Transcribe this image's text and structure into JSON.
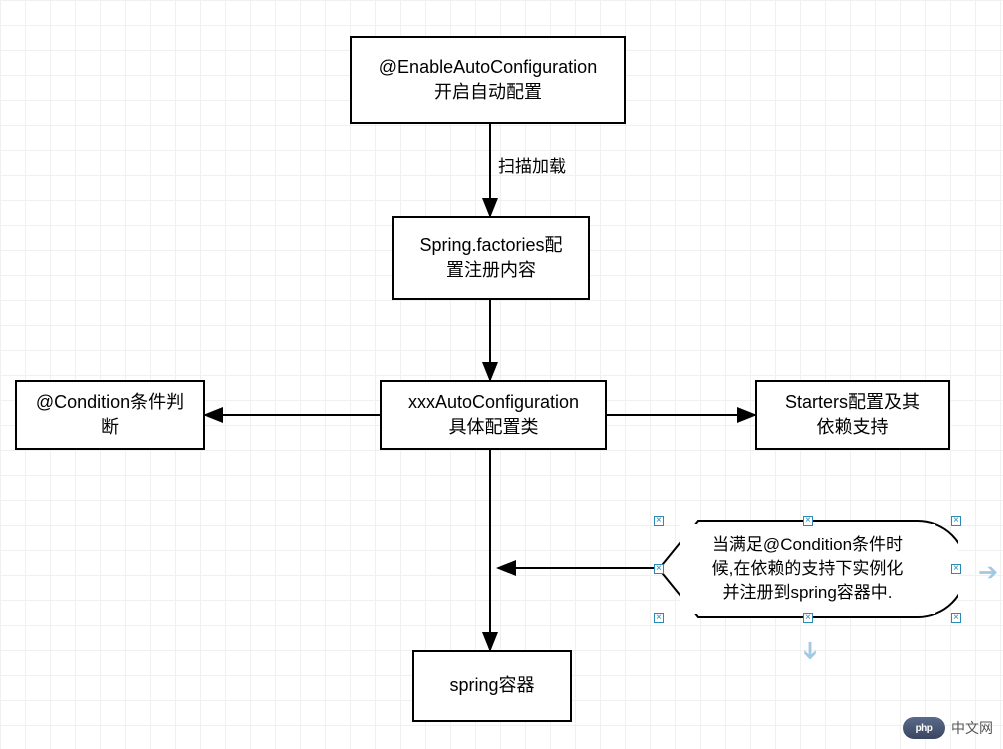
{
  "nodes": {
    "enable": {
      "line1": "@EnableAutoConfiguration",
      "line2": "开启自动配置"
    },
    "factories": {
      "line1": "Spring.factories配",
      "line2": "置注册内容"
    },
    "autoconfig": {
      "line1": "xxxAutoConfiguration",
      "line2": "具体配置类"
    },
    "condition": {
      "line1": "@Condition条件判",
      "line2": "断"
    },
    "starters": {
      "line1": "Starters配置及其",
      "line2": "依赖支持"
    },
    "container": {
      "text": "spring容器"
    }
  },
  "edges": {
    "scan_load": "扫描加载"
  },
  "callout": {
    "line1": "当满足@Condition条件时",
    "line2": "候,在依赖的支持下实例化",
    "line3": "并注册到spring容器中."
  },
  "watermark": {
    "logo": "php",
    "text": "中文网"
  },
  "colors": {
    "selection": "#2b8ab3",
    "grid": "#f0f0f0",
    "direction_hint": "#a3c9e2"
  }
}
